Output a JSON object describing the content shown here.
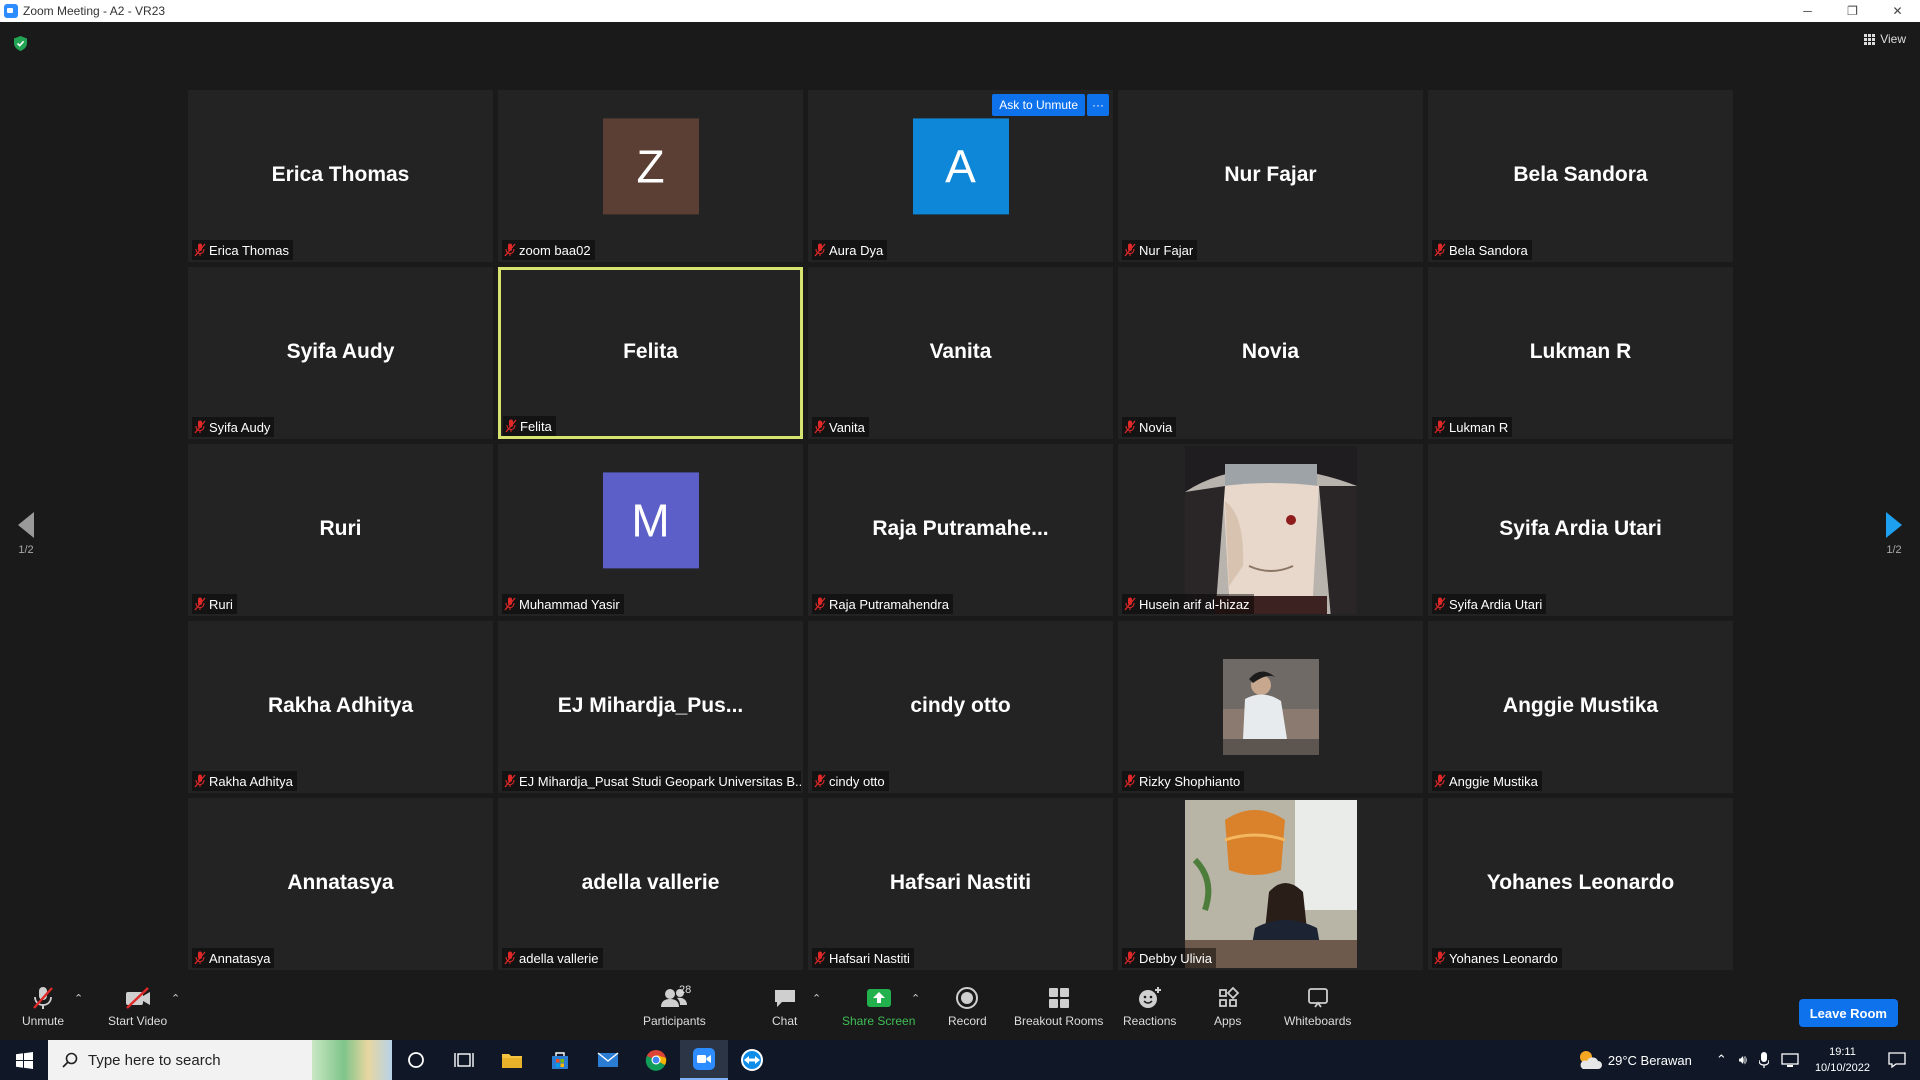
{
  "window": {
    "title": "Zoom Meeting - A2 - VR23",
    "minimize": "─",
    "restore": "❐",
    "close": "✕"
  },
  "meeting": {
    "view_label": "View",
    "page_left": "1/2",
    "page_right": "1/2",
    "ask_to_unmute": "Ask to Unmute",
    "more": "···",
    "tiles": [
      {
        "big": "Erica Thomas",
        "label": "Erica Thomas",
        "kind": "name"
      },
      {
        "big": "Z",
        "label": "zoom baa02",
        "kind": "avatar",
        "color": "#5b3f35"
      },
      {
        "big": "A",
        "label": "Aura Dya",
        "kind": "avatar",
        "color": "#0f87d8"
      },
      {
        "big": "Nur Fajar",
        "label": "Nur Fajar",
        "kind": "name"
      },
      {
        "big": "Bela Sandora",
        "label": "Bela Sandora",
        "kind": "name"
      },
      {
        "big": "Syifa Audy",
        "label": "Syifa Audy",
        "kind": "name"
      },
      {
        "big": "Felita",
        "label": "Felita",
        "kind": "name",
        "active": true
      },
      {
        "big": "Vanita",
        "label": "Vanita",
        "kind": "name"
      },
      {
        "big": "Novia",
        "label": "Novia",
        "kind": "name"
      },
      {
        "big": "Lukman R",
        "label": "Lukman R",
        "kind": "name"
      },
      {
        "big": "Ruri",
        "label": "Ruri",
        "kind": "name"
      },
      {
        "big": "M",
        "label": "Muhammad Yasir",
        "kind": "avatar",
        "color": "#5b5fc7"
      },
      {
        "big": "Raja  Putramahe...",
        "label": "Raja Putramahendra",
        "kind": "name"
      },
      {
        "big": "",
        "label": "Husein arif al-hizaz",
        "kind": "photo-anime"
      },
      {
        "big": "Syifa Ardia Utari",
        "label": "Syifa Ardia Utari",
        "kind": "name"
      },
      {
        "big": "Rakha Adhitya",
        "label": "Rakha Adhitya",
        "kind": "name"
      },
      {
        "big": "EJ  Mihardja_Pus...",
        "label": "EJ Mihardja_Pusat Studi Geopark Universitas B...",
        "kind": "name"
      },
      {
        "big": "cindy otto",
        "label": "cindy otto",
        "kind": "name"
      },
      {
        "big": "",
        "label": "Rizky Shophianto",
        "kind": "photo-small"
      },
      {
        "big": "Anggie Mustika",
        "label": "Anggie Mustika",
        "kind": "name"
      },
      {
        "big": "Annatasya",
        "label": "Annatasya",
        "kind": "name"
      },
      {
        "big": "adella vallerie",
        "label": "adella vallerie",
        "kind": "name"
      },
      {
        "big": "Hafsari Nastiti",
        "label": "Hafsari Nastiti",
        "kind": "name"
      },
      {
        "big": "",
        "label": "Debby Ulivia",
        "kind": "photo-lamp"
      },
      {
        "big": "Yohanes Leonardo",
        "label": "Yohanes Leonardo",
        "kind": "name"
      }
    ]
  },
  "toolbar": {
    "unmute": "Unmute",
    "start_video": "Start Video",
    "participants": "Participants",
    "participants_count": "28",
    "chat": "Chat",
    "share_screen": "Share Screen",
    "record": "Record",
    "breakout_rooms": "Breakout Rooms",
    "reactions": "Reactions",
    "apps": "Apps",
    "whiteboards": "Whiteboards",
    "leave_room": "Leave Room"
  },
  "taskbar": {
    "search_placeholder": "Type here to search",
    "weather": "29°C  Berawan",
    "time": "19:11",
    "date": "10/10/2022"
  }
}
